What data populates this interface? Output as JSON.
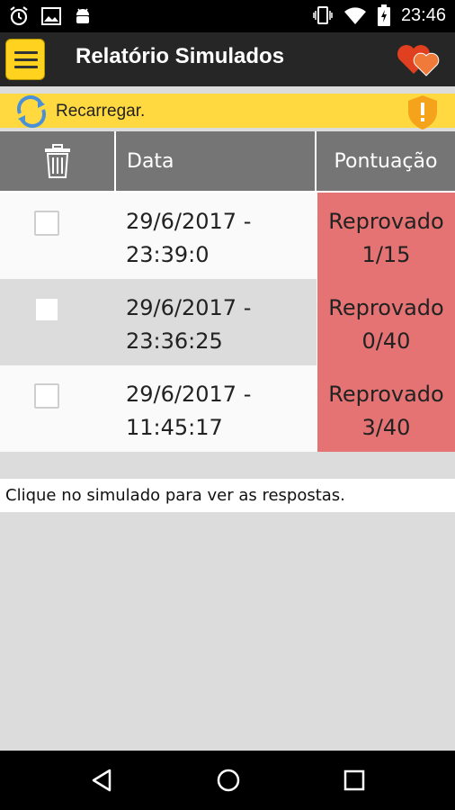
{
  "status_bar": {
    "time": "23:46",
    "left_icons": [
      "alarm-icon",
      "image-icon",
      "android-icon"
    ],
    "right_icons": [
      "vibrate-icon",
      "wifi-icon",
      "battery-icon"
    ]
  },
  "app_bar": {
    "title": "Relatório Simulados",
    "menu_icon": "hamburger-menu-icon",
    "right_icon": "hearts-icon",
    "accent_color": "#ffd21f"
  },
  "reload_bar": {
    "label": "Recarregar.",
    "left_icon": "reload-icon",
    "right_icon": "warning-shield-icon",
    "bg_color": "#ffd93f"
  },
  "table": {
    "headers": {
      "delete_icon": "trash-icon",
      "date": "Data",
      "score": "Pontuação"
    },
    "rows": [
      {
        "checked": false,
        "date_line1": "29/6/2017 -",
        "date_line2": "23:39:0",
        "status": "Reprovado",
        "score": "1/15"
      },
      {
        "checked": false,
        "date_line1": "29/6/2017 -",
        "date_line2": "23:36:25",
        "status": "Reprovado",
        "score": "0/40"
      },
      {
        "checked": false,
        "date_line1": "29/6/2017 -",
        "date_line2": "11:45:17",
        "status": "Reprovado",
        "score": "3/40"
      }
    ],
    "fail_color": "#e57373"
  },
  "hint": "Clique no simulado para ver as respostas.",
  "nav_bar": {
    "icons": [
      "back-icon",
      "home-icon",
      "recents-icon"
    ]
  }
}
